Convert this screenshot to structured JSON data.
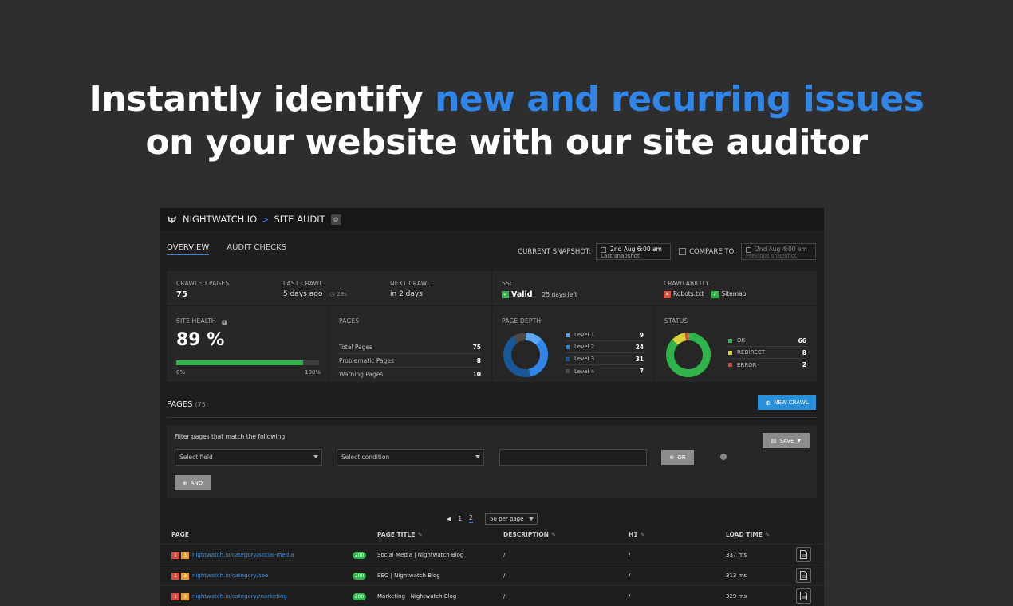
{
  "hero": {
    "line1_pre": "Instantly identify ",
    "line1_accent": "new and recurring issues",
    "line2": "on your website with our site auditor"
  },
  "topbar": {
    "brand": "NIGHTWATCH.IO",
    "separator": ">",
    "section": "SITE AUDIT"
  },
  "tabs": [
    {
      "label": "OVERVIEW",
      "active": true
    },
    {
      "label": "AUDIT CHECKS",
      "active": false
    }
  ],
  "snapshot": {
    "current_label": "CURRENT SNAPSHOT:",
    "current_date": "2nd Aug 6:00 am",
    "current_sub": "Last snapshot",
    "compare_label": "COMPARE TO:",
    "compare_date": "2nd Aug 4:00 am",
    "compare_sub": "Previous snapshot"
  },
  "stats": {
    "crawled_label": "CRAWLED PAGES",
    "crawled_value": "75",
    "last_crawl_label": "LAST CRAWL",
    "last_crawl_value": "5 days ago",
    "last_crawl_timer": "29s",
    "next_crawl_label": "NEXT CRAWL",
    "next_crawl_value": "in 2 days",
    "ssl_label": "SSL",
    "ssl_value": "Valid",
    "ssl_days": "25 days left",
    "crawlability_label": "CRAWLABILITY",
    "robots": "Robots.txt",
    "sitemap": "Sitemap"
  },
  "health": {
    "label": "SITE HEALTH",
    "value": "89 %",
    "percent": 89,
    "min": "0%",
    "max": "100%"
  },
  "pages_summary": {
    "label": "PAGES",
    "items": [
      {
        "label": "Total Pages",
        "value": "75"
      },
      {
        "label": "Problematic Pages",
        "value": "8"
      },
      {
        "label": "Warning Pages",
        "value": "10"
      }
    ]
  },
  "page_depth": {
    "label": "PAGE DEPTH",
    "items": [
      {
        "label": "Level 1",
        "value": 9,
        "color": "#5aa8f0"
      },
      {
        "label": "Level 2",
        "value": 24,
        "color": "#2f86e8"
      },
      {
        "label": "Level 3",
        "value": 31,
        "color": "#1a5796"
      },
      {
        "label": "Level 4",
        "value": 7,
        "color": "#4a4a4a"
      }
    ]
  },
  "status": {
    "label": "STATUS",
    "items": [
      {
        "label": "OK",
        "value": 66,
        "color": "#2fb34a"
      },
      {
        "label": "REDIRECT",
        "value": 8,
        "color": "#d8d23a"
      },
      {
        "label": "ERROR",
        "value": 2,
        "color": "#d84a3b"
      }
    ]
  },
  "pages_section": {
    "title": "PAGES",
    "count": "(75)",
    "new_crawl": "NEW CRAWL"
  },
  "filter": {
    "title": "Filter pages that match the following:",
    "field_placeholder": "Select field",
    "condition_placeholder": "Select condition",
    "or_label": "OR",
    "and_label": "AND",
    "save_label": "SAVE"
  },
  "pagination": {
    "pages": [
      "1",
      "2"
    ],
    "current": "2",
    "per_page": "50 per page"
  },
  "table": {
    "headers": {
      "page": "PAGE",
      "title": "PAGE TITLE",
      "description": "DESCRIPTION",
      "h1": "H1",
      "load": "LOAD TIME"
    },
    "rows": [
      {
        "err": "1",
        "warn": "3",
        "url": "nightwatch.io/category/social-media",
        "code": "200",
        "title": "Social Media | Nightwatch Blog",
        "description": "/",
        "h1": "/",
        "load": "337 ms"
      },
      {
        "err": "1",
        "warn": "3",
        "url": "nightwatch.io/category/seo",
        "code": "200",
        "title": "SEO | Nightwatch Blog",
        "description": "/",
        "h1": "/",
        "load": "313 ms"
      },
      {
        "err": "1",
        "warn": "3",
        "url": "nightwatch.io/category/marketing",
        "code": "200",
        "title": "Marketing | Nightwatch Blog",
        "description": "/",
        "h1": "/",
        "load": "329 ms"
      }
    ]
  }
}
